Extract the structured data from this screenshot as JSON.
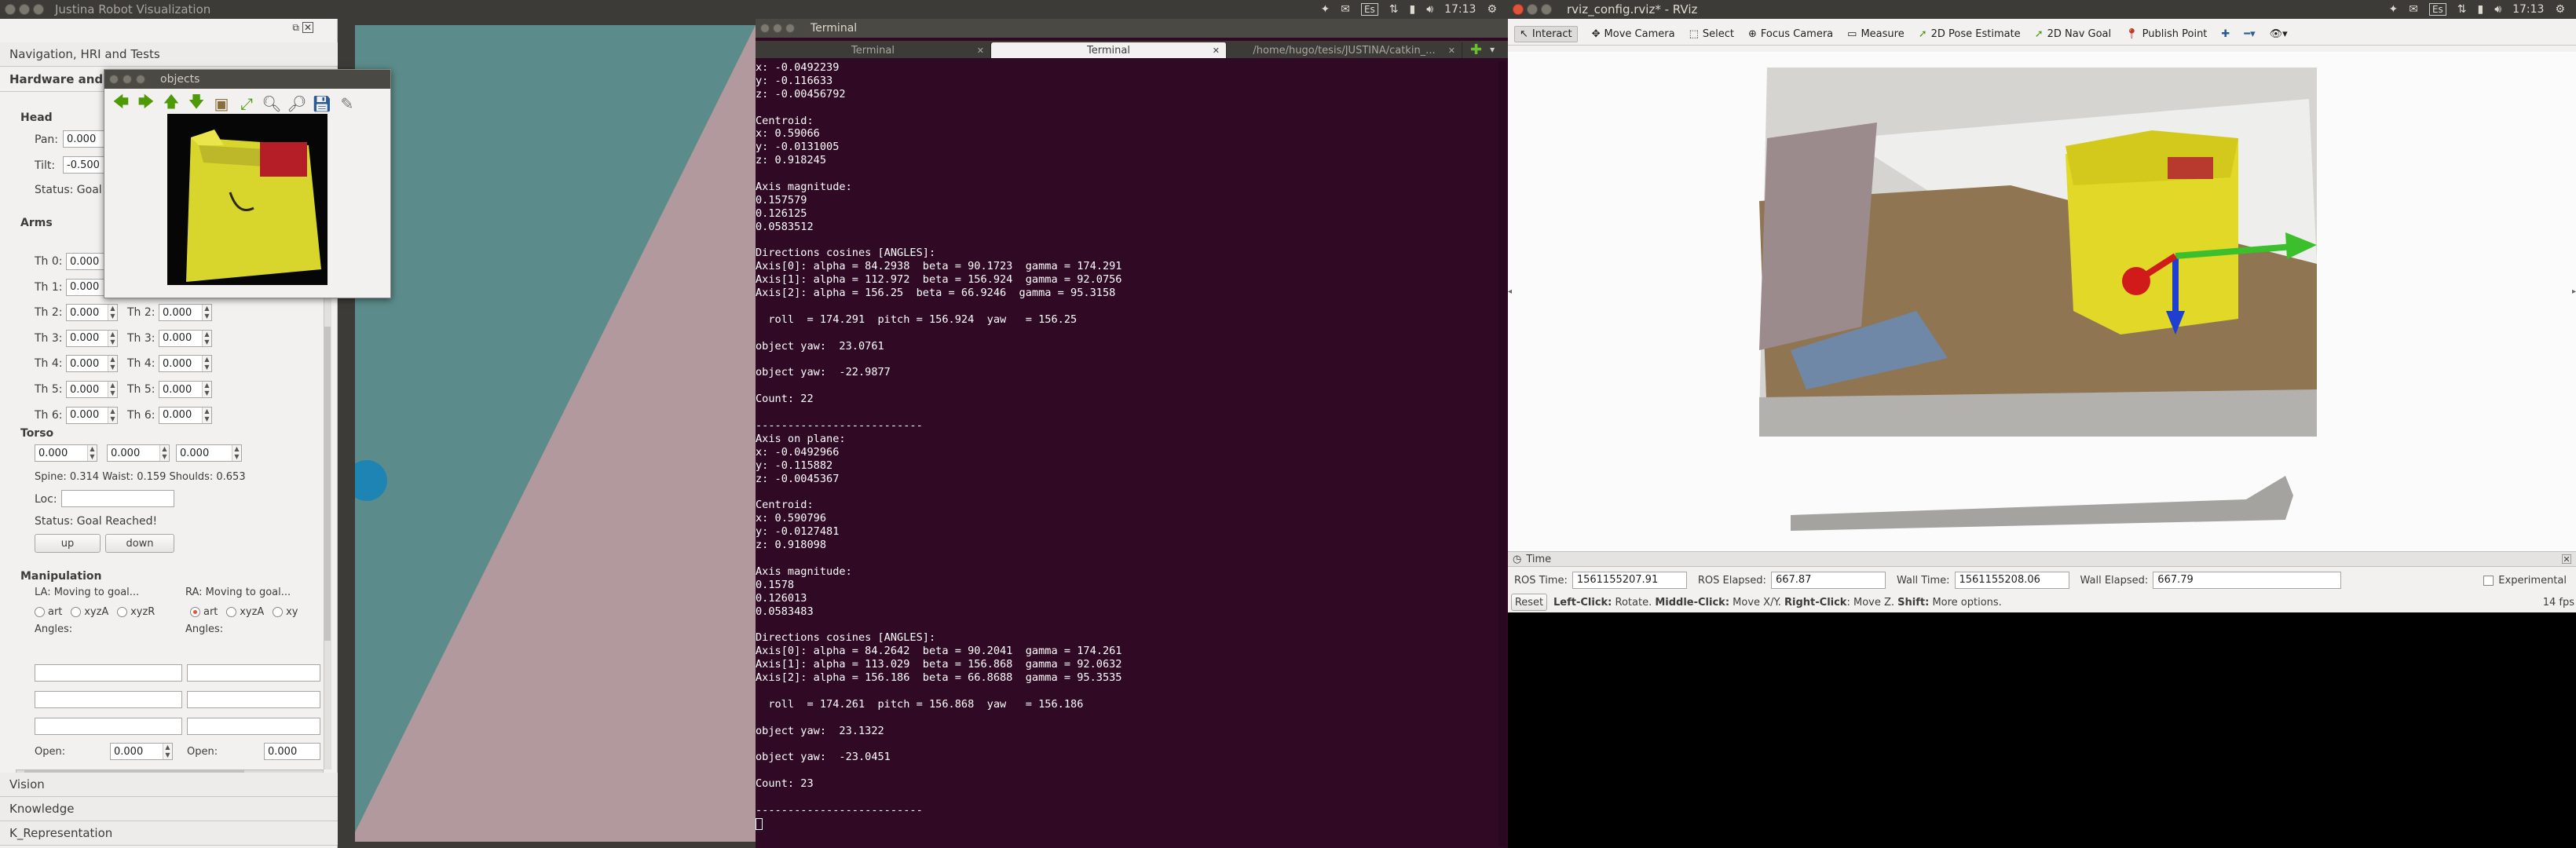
{
  "system": {
    "left_window_title": "Justina Robot Visualization",
    "rviz_window_title": "rviz_config.rviz* - RViz",
    "clock_left": "17:13",
    "clock_right": "17:13",
    "keyboard": "Es",
    "accent_orange": "#e0543a",
    "terminal_bg": "#300a24"
  },
  "left_panel": {
    "tabs_top": [
      "Navigation, HRI and Tests",
      "Hardware and Manipulation"
    ],
    "head": {
      "title": "Head",
      "pan_label": "Pan:",
      "pan_value": "0.000",
      "tilt_label": "Tilt:",
      "tilt_value": "-0.500",
      "status": "Status: Goal R"
    },
    "arms": {
      "title": "Arms",
      "left_labels": [
        "Th 0:",
        "Th 1:",
        "Th 2:",
        "Th 3:",
        "Th 4:",
        "Th 5:",
        "Th 6:"
      ],
      "left_values": [
        "0.000",
        "0.000",
        "0.000",
        "0.000",
        "0.000",
        "0.000",
        "0.000"
      ],
      "right_labels": [
        "Th 2:",
        "Th 3:",
        "Th 4:",
        "Th 5:",
        "Th 6:"
      ],
      "right_values": [
        "0.000",
        "0.000",
        "0.000",
        "0.000",
        "0.000"
      ]
    },
    "torso": {
      "title": "Torso",
      "values": [
        "0.000",
        "0.000",
        "0.000"
      ],
      "readout": "Spine: 0.314  Waist: 0.159  Shoulds: 0.653",
      "loc_label": "Loc:",
      "status": "Status: Goal Reached!",
      "up_label": "up",
      "down_label": "down"
    },
    "manipulation": {
      "title": "Manipulation",
      "la_status": "LA: Moving to goal...",
      "ra_status": "RA: Moving to goal...",
      "la_options": [
        "art",
        "xyzA",
        "xyzR"
      ],
      "ra_options": [
        "art",
        "xyzA",
        "xy"
      ],
      "angles_label": "Angles:",
      "open_label": "Open:",
      "la_open_value": "0.000",
      "ra_open_value": "0.000"
    },
    "tabs_bottom": [
      "Vision",
      "Knowledge",
      "K_Representation"
    ]
  },
  "objects_window": {
    "title": "objects"
  },
  "terminal": {
    "title": "Terminal",
    "tabs": [
      "Terminal",
      "Terminal",
      "/home/hugo/tesis/JUSTINA/catkin_..."
    ],
    "lines": [
      "x: -0.0492239",
      "y: -0.116633",
      "z: -0.00456792",
      "",
      "Centroid:",
      "x: 0.59066",
      "y: -0.0131005",
      "z: 0.918245",
      "",
      "Axis magnitude:",
      "0.157579",
      "0.126125",
      "0.0583512",
      "",
      "Directions cosines [ANGLES]:",
      "Axis[0]: alpha = 84.2938  beta = 90.1723  gamma = 174.291",
      "Axis[1]: alpha = 112.972  beta = 156.924  gamma = 92.0756",
      "Axis[2]: alpha = 156.25  beta = 66.9246  gamma = 95.3158",
      "",
      "  roll  = 174.291  pitch = 156.924  yaw   = 156.25",
      "",
      "object yaw:  23.0761",
      "",
      "object yaw:  -22.9877",
      "",
      "Count: 22",
      "",
      "--------------------------",
      "Axis on plane:",
      "x: -0.0492966",
      "y: -0.115882",
      "z: -0.0045367",
      "",
      "Centroid:",
      "x: 0.590796",
      "y: -0.0127481",
      "z: 0.918098",
      "",
      "Axis magnitude:",
      "0.1578",
      "0.126013",
      "0.0583483",
      "",
      "Directions cosines [ANGLES]:",
      "Axis[0]: alpha = 84.2642  beta = 90.2041  gamma = 174.261",
      "Axis[1]: alpha = 113.029  beta = 156.868  gamma = 92.0632",
      "Axis[2]: alpha = 156.186  beta = 66.8688  gamma = 95.3535",
      "",
      "  roll  = 174.261  pitch = 156.868  yaw   = 156.186",
      "",
      "object yaw:  23.1322",
      "",
      "object yaw:  -23.0451",
      "",
      "Count: 23",
      "",
      "--------------------------"
    ]
  },
  "rviz": {
    "tools": [
      "Interact",
      "Move Camera",
      "Select",
      "Focus Camera",
      "Measure",
      "2D Pose Estimate",
      "2D Nav Goal",
      "Publish Point"
    ],
    "time_panel_title": "Time",
    "ros_time_label": "ROS Time:",
    "ros_time_value": "1561155207.91",
    "ros_elapsed_label": "ROS Elapsed:",
    "ros_elapsed_value": "667.87",
    "wall_time_label": "Wall Time:",
    "wall_time_value": "1561155208.06",
    "wall_elapsed_label": "Wall Elapsed:",
    "wall_elapsed_value": "667.79",
    "experimental_label": "Experimental",
    "reset_label": "Reset",
    "hint_left_click": "Left-Click:",
    "hint_left_text": " Rotate. ",
    "hint_middle_click": "Middle-Click:",
    "hint_middle_text": " Move X/Y. ",
    "hint_right_click": "Right-Click:",
    "hint_right_text": ": Move Z. ",
    "hint_shift": "Shift:",
    "hint_shift_text": " More options.",
    "fps": "14 fps"
  }
}
